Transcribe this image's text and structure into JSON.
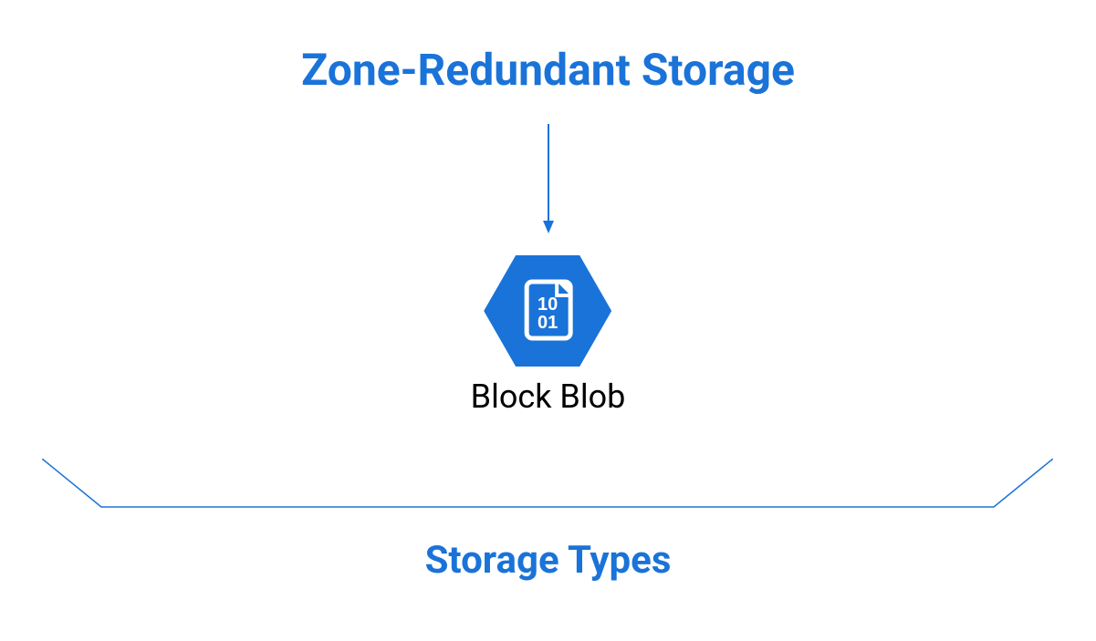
{
  "diagram": {
    "title_top": "Zone-Redundant Storage",
    "node_label": "Block Blob",
    "title_bottom": "Storage Types",
    "icon_name": "binary-file-icon",
    "icon_text_top": "10",
    "icon_text_bottom": "01",
    "colors": {
      "primary": "#1a73d8",
      "text_black": "#000000"
    }
  }
}
